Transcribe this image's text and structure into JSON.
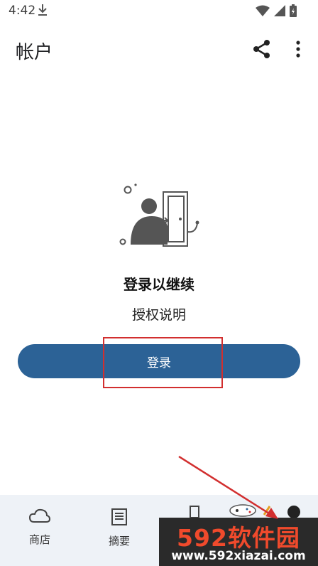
{
  "status_bar": {
    "time": "4:42"
  },
  "app_bar": {
    "title": "帐户"
  },
  "main": {
    "heading": "登录以继续",
    "subtext": "授权说明",
    "login_button": "登录"
  },
  "bottom_nav": {
    "items": [
      {
        "label": "商店",
        "icon": "cloud-icon"
      },
      {
        "label": "摘要",
        "icon": "digest-icon"
      }
    ]
  },
  "watermark": {
    "brand": "592软件园",
    "url": "www.592xiazai.com"
  },
  "colors": {
    "primary": "#2c6296",
    "annotation": "#d22f2f",
    "nav_bg": "#eef2f7"
  }
}
